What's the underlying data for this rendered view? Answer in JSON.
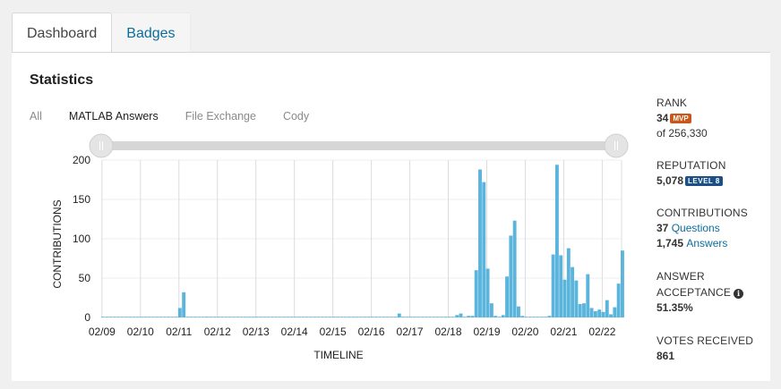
{
  "tabs": [
    {
      "label": "Dashboard",
      "active": true
    },
    {
      "label": "Badges",
      "active": false
    }
  ],
  "statistics": {
    "title": "Statistics",
    "filters": [
      {
        "label": "All",
        "active": false
      },
      {
        "label": "MATLAB Answers",
        "active": true
      },
      {
        "label": "File Exchange",
        "active": false
      },
      {
        "label": "Cody",
        "active": false
      }
    ],
    "range_slider": {
      "start_fraction": 0.0,
      "end_fraction": 1.0
    }
  },
  "side": {
    "rank_label": "RANK",
    "rank_value": "34",
    "rank_badge": "MVP",
    "rank_of": "of 256,330",
    "reputation_label": "REPUTATION",
    "reputation_value": "5,078",
    "reputation_badge": "LEVEL 8",
    "contributions_label": "CONTRIBUTIONS",
    "questions_count": "37",
    "questions_label": "Questions",
    "answers_count": "1,745",
    "answers_label": "Answers",
    "acceptance_label_1": "ANSWER",
    "acceptance_label_2": "ACCEPTANCE",
    "acceptance_value": "51.35%",
    "votes_label": "VOTES RECEIVED",
    "votes_value": "861"
  },
  "colors": {
    "bar": "#5ab4dc",
    "slider_track": "#d6d6d6",
    "tab_link": "#0b6d9c",
    "mvp": "#c9561b",
    "level": "#1b4f86"
  },
  "chart_data": {
    "type": "bar",
    "xlabel": "TIMELINE",
    "ylabel": "CONTRIBUTIONS",
    "ylim": [
      0,
      200
    ],
    "yticks": [
      0,
      50,
      100,
      150,
      200
    ],
    "xticks": [
      "02/09",
      "02/10",
      "02/11",
      "02/12",
      "02/13",
      "02/14",
      "02/15",
      "02/16",
      "02/17",
      "02/18",
      "02/19",
      "02/20",
      "02/21",
      "02/22"
    ],
    "x_start": "02/09",
    "bars_per_tick": 10,
    "values": [
      0,
      0,
      0,
      0,
      0,
      0,
      0,
      0,
      0,
      0,
      0,
      0,
      0,
      0,
      0,
      0,
      0,
      0,
      0,
      0,
      12,
      32,
      0,
      0,
      0,
      0,
      0,
      1,
      0,
      0,
      0,
      0,
      0,
      0,
      0,
      0,
      0,
      0,
      0,
      0,
      0,
      0,
      0,
      0,
      0,
      0,
      0,
      0,
      0,
      0,
      0,
      0,
      0,
      0,
      0,
      0,
      0,
      0,
      0,
      0,
      0,
      0,
      0,
      0,
      0,
      0,
      0,
      0,
      0,
      0,
      0,
      0,
      0,
      0,
      0,
      0,
      0,
      5,
      0,
      0,
      0,
      0,
      0,
      0,
      0,
      0,
      0,
      0,
      0,
      0,
      0,
      0,
      3,
      5,
      0,
      2,
      2,
      60,
      188,
      172,
      62,
      18,
      2,
      0,
      3,
      52,
      104,
      123,
      14,
      2,
      0,
      0,
      0,
      0,
      0,
      0,
      2,
      80,
      194,
      79,
      48,
      88,
      64,
      47,
      17,
      18,
      55,
      12,
      8,
      10,
      7,
      22,
      4,
      13,
      43,
      85
    ]
  }
}
